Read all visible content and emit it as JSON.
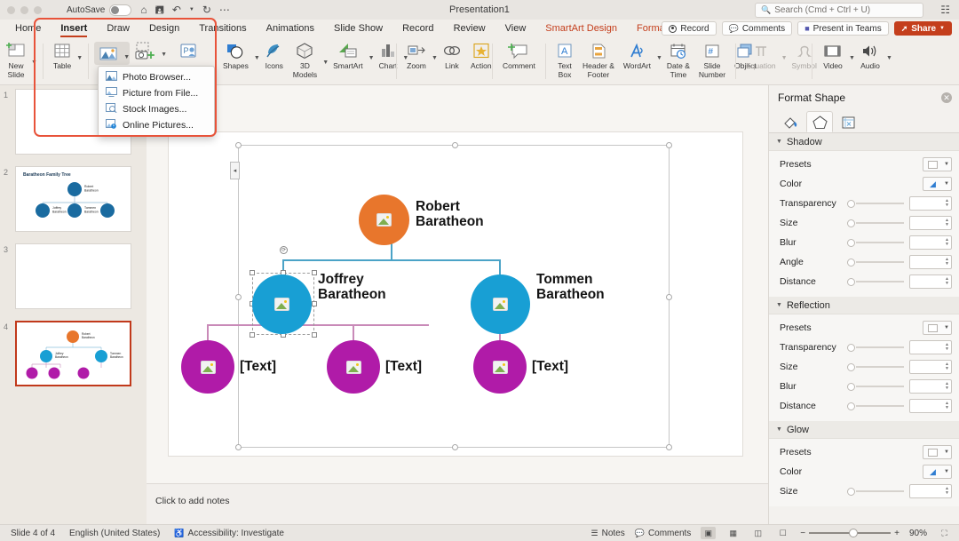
{
  "titlebar": {
    "autosave_label": "AutoSave",
    "autosave_state": "off",
    "document_title": "Presentation1",
    "icons": [
      "home-icon",
      "save-icon",
      "undo-icon",
      "undo-caret",
      "redo-icon",
      "more-icon"
    ],
    "search_placeholder": "Search (Cmd + Ctrl + U)"
  },
  "tabs": [
    {
      "label": "Home",
      "active": false,
      "contextual": false
    },
    {
      "label": "Insert",
      "active": true,
      "contextual": false
    },
    {
      "label": "Draw",
      "active": false,
      "contextual": false
    },
    {
      "label": "Design",
      "active": false,
      "contextual": false
    },
    {
      "label": "Transitions",
      "active": false,
      "contextual": false
    },
    {
      "label": "Animations",
      "active": false,
      "contextual": false
    },
    {
      "label": "Slide Show",
      "active": false,
      "contextual": false
    },
    {
      "label": "Record",
      "active": false,
      "contextual": false
    },
    {
      "label": "Review",
      "active": false,
      "contextual": false
    },
    {
      "label": "View",
      "active": false,
      "contextual": false
    },
    {
      "label": "SmartArt Design",
      "active": false,
      "contextual": true
    },
    {
      "label": "Format",
      "active": false,
      "contextual": true
    }
  ],
  "tab_actions": {
    "record": "Record",
    "comments": "Comments",
    "present_in_teams": "Present in Teams",
    "share": "Share"
  },
  "ribbon": {
    "groups": [
      {
        "items": [
          {
            "label": "New\nSlide",
            "icon": "new-slide-icon",
            "caret": true,
            "dim": false
          },
          {
            "label": "Table",
            "icon": "table-icon",
            "caret": true,
            "dim": false
          },
          {
            "label": "",
            "icon": "pictures-icon",
            "caret": true,
            "dim": false,
            "active": true
          },
          {
            "label": "",
            "icon": "screenshot-icon",
            "caret": true,
            "dim": false
          },
          {
            "label": "",
            "icon": "photo-album-icon",
            "caret": false,
            "dim": false
          }
        ]
      },
      {
        "items": [
          {
            "label": "Shapes",
            "icon": "shapes-icon",
            "caret": true,
            "dim": false
          },
          {
            "label": "Icons",
            "icon": "icons-icon",
            "caret": false,
            "dim": false
          },
          {
            "label": "3D\nModels",
            "icon": "3d-models-icon",
            "caret": true,
            "dim": false
          },
          {
            "label": "SmartArt",
            "icon": "smartart-icon",
            "caret": true,
            "dim": false
          },
          {
            "label": "Chart",
            "icon": "chart-icon",
            "caret": true,
            "dim": false
          }
        ]
      },
      {
        "items": [
          {
            "label": "Zoom",
            "icon": "zoom-icon",
            "caret": true,
            "dim": false
          },
          {
            "label": "Link",
            "icon": "link-icon",
            "caret": false,
            "dim": false
          },
          {
            "label": "Action",
            "icon": "action-icon",
            "caret": false,
            "dim": false
          }
        ]
      },
      {
        "items": [
          {
            "label": "Comment",
            "icon": "comment-icon",
            "caret": false,
            "dim": false
          }
        ]
      },
      {
        "items": [
          {
            "label": "Text\nBox",
            "icon": "text-box-icon",
            "caret": false,
            "dim": false
          },
          {
            "label": "Header &\nFooter",
            "icon": "header-footer-icon",
            "caret": false,
            "dim": false
          },
          {
            "label": "WordArt",
            "icon": "wordart-icon",
            "caret": true,
            "dim": false
          },
          {
            "label": "Date &\nTime",
            "icon": "date-time-icon",
            "caret": false,
            "dim": false
          },
          {
            "label": "Slide\nNumber",
            "icon": "slide-number-icon",
            "caret": false,
            "dim": false
          },
          {
            "label": "Object",
            "icon": "object-icon",
            "caret": false,
            "dim": false
          }
        ]
      },
      {
        "items": [
          {
            "label": "Equation",
            "icon": "equation-icon",
            "caret": true,
            "dim": true
          },
          {
            "label": "Symbol",
            "icon": "symbol-icon",
            "caret": false,
            "dim": true
          }
        ]
      },
      {
        "items": [
          {
            "label": "Video",
            "icon": "video-icon",
            "caret": true,
            "dim": false
          },
          {
            "label": "Audio",
            "icon": "audio-icon",
            "caret": true,
            "dim": false
          }
        ]
      }
    ]
  },
  "dropdown": {
    "items": [
      {
        "label": "Photo Browser...",
        "icon": "photo-browser-icon"
      },
      {
        "label": "Picture from File...",
        "icon": "picture-from-file-icon"
      },
      {
        "label": "Stock Images...",
        "icon": "stock-images-icon"
      },
      {
        "label": "Online Pictures...",
        "icon": "online-pictures-icon"
      }
    ]
  },
  "thumbnails": [
    {
      "number": "1",
      "title": "",
      "selected": false,
      "has_diagram": false
    },
    {
      "number": "2",
      "title": "Baratheon Family Tree",
      "selected": false,
      "has_diagram": true
    },
    {
      "number": "3",
      "title": "",
      "selected": false,
      "has_diagram": false
    },
    {
      "number": "4",
      "title": "",
      "selected": true,
      "has_diagram": true
    }
  ],
  "slide": {
    "notes_placeholder": "Click to add notes",
    "diagram": {
      "type": "org-chart",
      "nodes": [
        {
          "id": "robert",
          "label": "Robert\nBaratheon",
          "color": "#E8762C",
          "level": 0,
          "selected": false
        },
        {
          "id": "joffrey",
          "label": "Joffrey\nBaratheon",
          "color": "#189FD4",
          "level": 1,
          "selected": true
        },
        {
          "id": "tommen",
          "label": "Tommen\nBaratheon",
          "color": "#189FD4",
          "level": 1,
          "selected": false
        },
        {
          "id": "child1",
          "label": "[Text]",
          "color": "#B01BA8",
          "level": 2,
          "selected": false
        },
        {
          "id": "child2",
          "label": "[Text]",
          "color": "#B01BA8",
          "level": 2,
          "selected": false
        },
        {
          "id": "child3",
          "label": "[Text]",
          "color": "#B01BA8",
          "level": 2,
          "selected": false
        }
      ],
      "connector_colors": {
        "level1": "#4BA3C7",
        "level2": "#C98AB8"
      }
    }
  },
  "format_pane": {
    "title": "Format Shape",
    "tabs": [
      {
        "icon": "fill-line-icon",
        "active": false
      },
      {
        "icon": "effects-pentagon-icon",
        "active": true
      },
      {
        "icon": "size-properties-icon",
        "active": false
      }
    ],
    "sections": [
      {
        "name": "Shadow",
        "rows": [
          {
            "label": "Presets",
            "control": "swatch-white"
          },
          {
            "label": "Color",
            "control": "swatch-color"
          },
          {
            "label": "Transparency",
            "control": "slider",
            "value": ""
          },
          {
            "label": "Size",
            "control": "slider",
            "value": ""
          },
          {
            "label": "Blur",
            "control": "slider",
            "value": ""
          },
          {
            "label": "Angle",
            "control": "slider",
            "value": ""
          },
          {
            "label": "Distance",
            "control": "slider",
            "value": ""
          }
        ]
      },
      {
        "name": "Reflection",
        "rows": [
          {
            "label": "Presets",
            "control": "swatch-white"
          },
          {
            "label": "Transparency",
            "control": "slider",
            "value": ""
          },
          {
            "label": "Size",
            "control": "slider",
            "value": ""
          },
          {
            "label": "Blur",
            "control": "slider",
            "value": ""
          },
          {
            "label": "Distance",
            "control": "slider",
            "value": ""
          }
        ]
      },
      {
        "name": "Glow",
        "rows": [
          {
            "label": "Presets",
            "control": "swatch-white"
          },
          {
            "label": "Color",
            "control": "swatch-color"
          },
          {
            "label": "Size",
            "control": "slider",
            "value": ""
          }
        ]
      }
    ]
  },
  "statusbar": {
    "slide_counter": "Slide 4 of 4",
    "language": "English (United States)",
    "accessibility": "Accessibility: Investigate",
    "notes": "Notes",
    "comments": "Comments",
    "zoom_level": "90%"
  },
  "colors": {
    "accent": "#C43E1C",
    "annotation": "#E8533A",
    "orange_node": "#E8762C",
    "blue_node": "#189FD4",
    "magenta_node": "#B01BA8"
  }
}
